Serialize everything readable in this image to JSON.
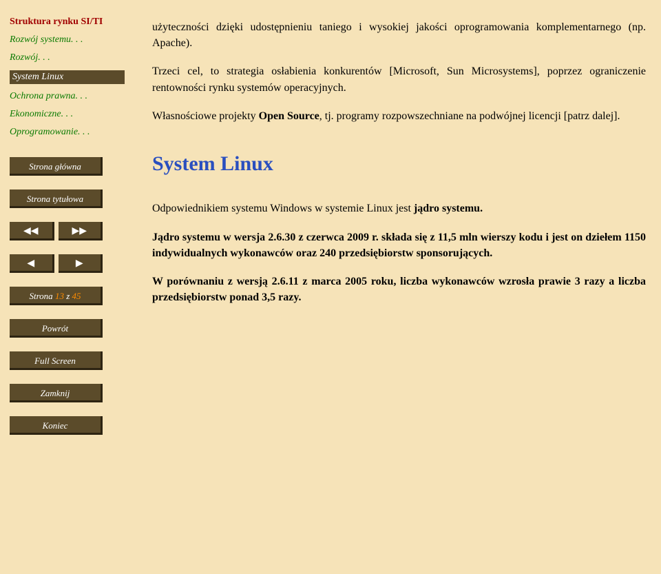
{
  "sidebar": {
    "toc": [
      {
        "label": "Struktura rynku SI/TI",
        "kind": "bold"
      },
      {
        "label": "Rozwój systemu. . .",
        "kind": "green"
      },
      {
        "label": "Rozwój. . .",
        "kind": "green"
      },
      {
        "label": "System Linux",
        "kind": "current"
      },
      {
        "label": "Ochrona prawna. . .",
        "kind": "green"
      },
      {
        "label": "Ekonomiczne. . .",
        "kind": "green"
      },
      {
        "label": "Oprogramowanie. . .",
        "kind": "green"
      }
    ],
    "home": "Strona główna",
    "title_page": "Strona tytułowa",
    "page_label_pre": "Strona ",
    "page_current": "13",
    "page_label_mid": " z ",
    "page_total": "45",
    "back": "Powrót",
    "fullscreen": "Full Screen",
    "close": "Zamknij",
    "end": "Koniec",
    "prev_fast": "◀◀",
    "next_fast": "▶▶",
    "prev": "◀",
    "next": "▶"
  },
  "content": {
    "p1": "użyteczności dzięki udostępnieniu taniego i wysokiej jakości oprogramowania komplementarnego (np. Apache).",
    "p2": "Trzeci cel, to strategia osłabienia konkurentów [Microsoft, Sun Microsystems], poprzez ograniczenie rentowności rynku systemów operacyjnych.",
    "p3a": "Własnościowe projekty ",
    "p3b": "Open Source",
    "p3c": ", tj. programy rozpowszechniane na podwójnej licencji [patrz dalej].",
    "heading": "System Linux",
    "p4a": "Odpowiednikiem systemu Windows w systemie Linux jest ",
    "p4b": "jądro systemu.",
    "p5a": "Jądro systemu w wersja 2.6.30 z czerwca 2009 r.",
    "p5b": " składa się z 11,5 mln wierszy kodu i jest on dziełem 1150 indywidualnych wykonawców oraz 240 przedsiębiorstw sponsorujących.",
    "p6a": "W porównaniu z wersją 2.6.11 z marca 2005 roku, liczba wykonawców wzrosła prawie 3 razy a liczba przedsiębiorstw ponad 3,5 razy."
  }
}
